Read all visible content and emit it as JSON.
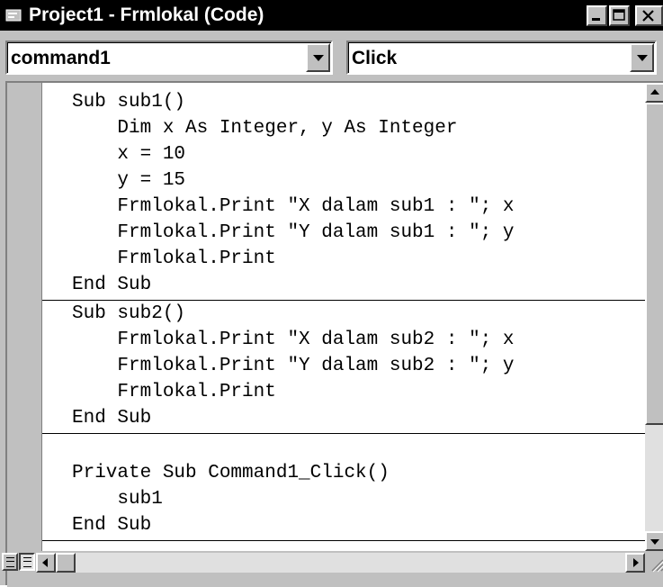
{
  "window": {
    "title": "Project1 - Frmlokal (Code)",
    "icon": "code-window-icon",
    "buttons": [
      "minimize-icon",
      "maximize-icon",
      "close-icon"
    ]
  },
  "combos": {
    "object": {
      "value": "command1"
    },
    "procedure": {
      "value": "Click"
    }
  },
  "code": {
    "sub1": [
      "Sub sub1()",
      "    Dim x As Integer, y As Integer",
      "    x = 10",
      "    y = 15",
      "    Frmlokal.Print \"X dalam sub1 : \"; x",
      "    Frmlokal.Print \"Y dalam sub1 : \"; y",
      "    Frmlokal.Print",
      "End Sub"
    ],
    "sub2": [
      "Sub sub2()",
      "    Frmlokal.Print \"X dalam sub2 : \"; x",
      "    Frmlokal.Print \"Y dalam sub2 : \"; y",
      "    Frmlokal.Print",
      "End Sub"
    ],
    "click": [
      "",
      "Private Sub Command1_Click()",
      "    sub1",
      "End Sub"
    ]
  },
  "colors": {
    "titlebar": "#000000",
    "chrome": "#c0c0c0",
    "editor_bg": "#ffffff",
    "text": "#000000"
  }
}
